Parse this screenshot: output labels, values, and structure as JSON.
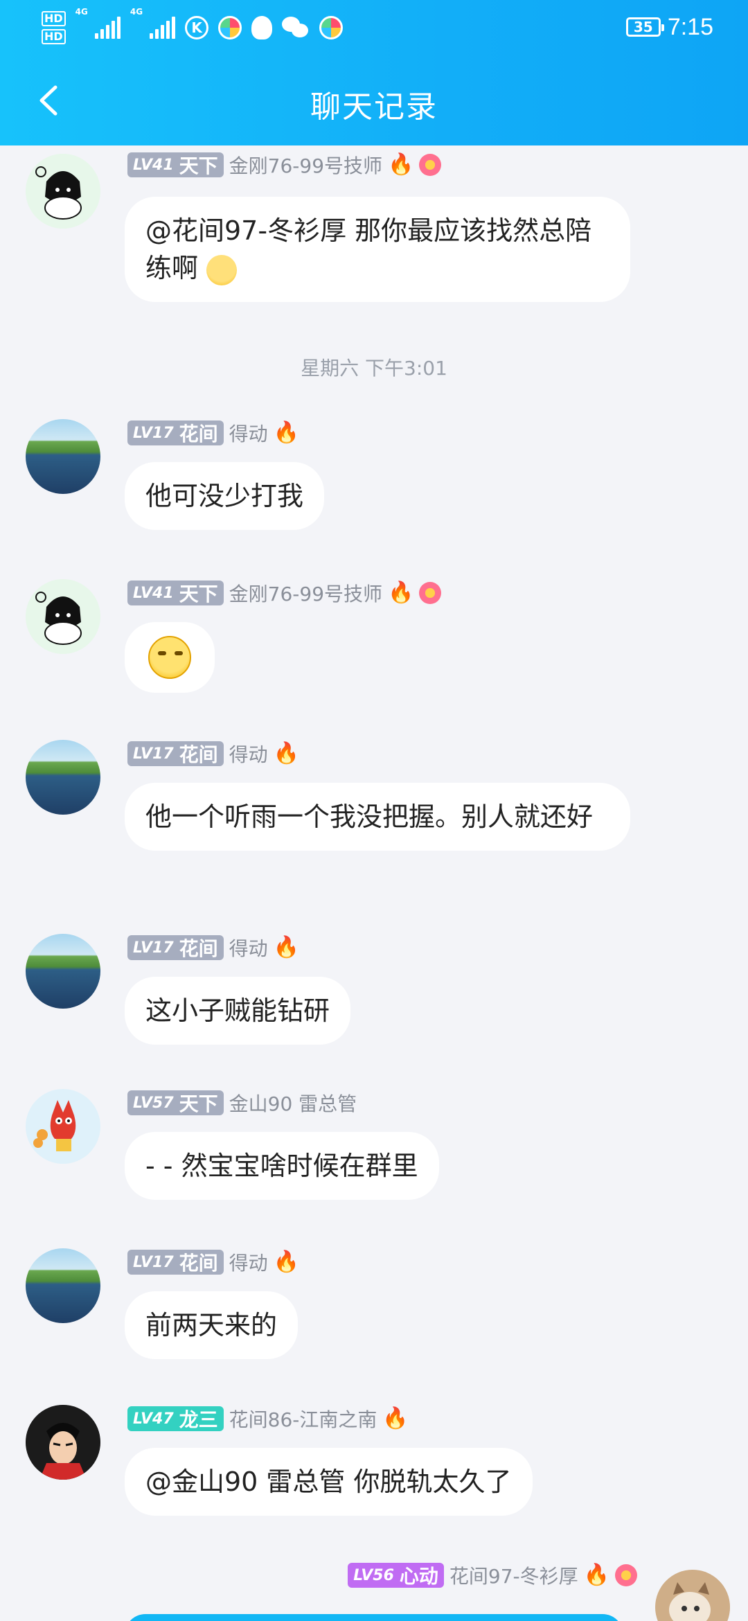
{
  "status_bar": {
    "hd1": "HD",
    "hd2": "HD",
    "net1": "4G",
    "net2": "4G",
    "app_k": "K",
    "battery": "35",
    "time": "7:15"
  },
  "nav": {
    "title": "聊天记录"
  },
  "timestamp": "星期六 下午3:01",
  "messages": [
    {
      "level": "LV41",
      "rank": "天下",
      "nick": "金刚76-99号技师",
      "text": "@花间97-冬衫厚 那你最应该找然总陪练啊"
    },
    {
      "level": "LV17",
      "rank": "花间",
      "nick": "得动",
      "text": "他可没少打我"
    },
    {
      "level": "LV41",
      "rank": "天下",
      "nick": "金刚76-99号技师",
      "text": ""
    },
    {
      "level": "LV17",
      "rank": "花间",
      "nick": "得动",
      "text": "他一个听雨一个我没把握。别人就还好"
    },
    {
      "level": "LV17",
      "rank": "花间",
      "nick": "得动",
      "text": "这小子贼能钻研"
    },
    {
      "level": "LV57",
      "rank": "天下",
      "nick": "金山90 雷总管",
      "text": "- - 然宝宝啥时候在群里"
    },
    {
      "level": "LV17",
      "rank": "花间",
      "nick": "得动",
      "text": "前两天来的"
    },
    {
      "level": "LV47",
      "rank": "龙三",
      "nick": "花间86-江南之南",
      "text": "@金山90 雷总管 你脱轨太久了"
    },
    {
      "level": "LV56",
      "rank": "心动",
      "nick": "花间97-冬衫厚",
      "text": ""
    }
  ],
  "colors": {
    "header_start": "#17c2fb",
    "header_end": "#0ea5f5",
    "background": "#f3f4f8",
    "badge_gray": "#a6adbf",
    "badge_teal": "#33d1c1",
    "badge_purple": "#c06cf3",
    "bubble_mine": "#12b7f5"
  }
}
